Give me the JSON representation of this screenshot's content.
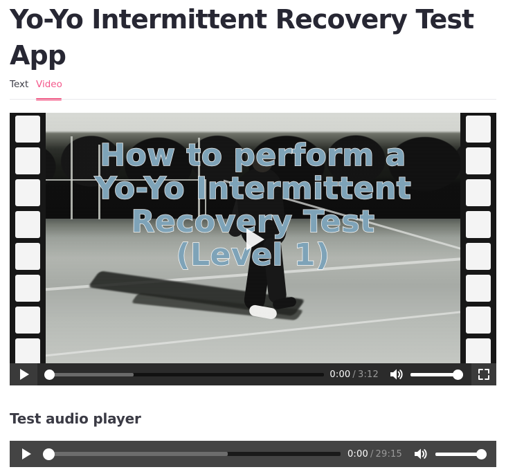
{
  "page": {
    "title": "Yo-Yo Intermittent Recovery Test App",
    "background_color": "#ffffff"
  },
  "tabs": {
    "items": [
      {
        "label": "Text",
        "active": false
      },
      {
        "label": "Video",
        "active": true
      }
    ],
    "active_color": "#f21e5a",
    "active_label_color": "#f4578a",
    "inactive_label_color": "#3c3c46"
  },
  "video": {
    "poster_title": "How to perform a\nYo-Yo Intermittent\nRecovery Test\n(Level 1)",
    "poster_title_color": "#7ea3b8",
    "big_play_icon": "play-triangle-icon",
    "controls": {
      "play_icon": "play-icon",
      "current_time": "0:00",
      "time_separator": "/",
      "duration": "3:12",
      "volume_icon": "volume-high-icon",
      "fullscreen_icon": "fullscreen-icon",
      "seek_progress_percent": 0,
      "seek_buffered_percent": 32,
      "volume_percent": 100,
      "background_color": "#2b2b2b"
    }
  },
  "audio_section": {
    "heading": "Test audio player",
    "controls": {
      "play_icon": "play-icon",
      "current_time": "0:00",
      "time_separator": "/",
      "duration": "29:15",
      "volume_icon": "volume-high-icon",
      "seek_progress_percent": 0,
      "seek_buffered_percent": 62,
      "volume_percent": 100,
      "background_color": "#444444"
    }
  }
}
